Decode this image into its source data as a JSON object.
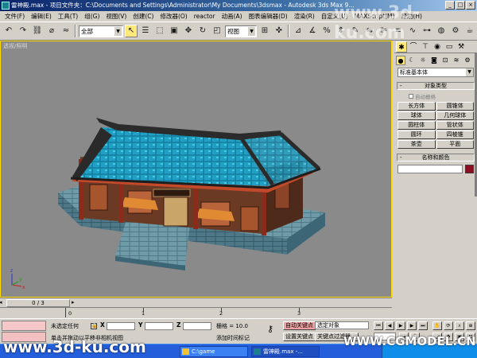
{
  "window": {
    "title": "雷神殿.max   - 项目文件夹：C:\\Documents and Settings\\Administrator\\My Documents\\3dsmax   - Autodesk 3ds Max 9...",
    "controls": [
      "_",
      "□",
      "×"
    ]
  },
  "menu": [
    "文件(F)",
    "编辑(E)",
    "工具(T)",
    "组(G)",
    "视图(V)",
    "创建(C)",
    "修改器(O)",
    "reactor",
    "动画(A)",
    "图表编辑器(D)",
    "渲染(R)",
    "自定义(U)",
    "MAXScript(M)",
    "帮助(H)"
  ],
  "toolbar": {
    "selection_filter": "全部",
    "coord_system": "视图"
  },
  "viewport": {
    "label": "透视/照明",
    "axes": {
      "x": "x",
      "y": "y",
      "z": "z"
    }
  },
  "command_panel": {
    "category_dropdown": "标准基本体",
    "object_type_header": "对象类型",
    "autogrid_label": "自动栅格",
    "object_buttons": [
      "长方体",
      "圆锥体",
      "球体",
      "几何球体",
      "圆柱体",
      "管状体",
      "圆环",
      "四棱锥",
      "茶壶",
      "平面"
    ],
    "name_color_header": "名称和颜色",
    "object_color": "#8b0f22"
  },
  "timeline": {
    "frame_display": "0 / 3",
    "ticks": [
      "0",
      "1",
      "2",
      "3"
    ]
  },
  "status": {
    "selection_status": "未选定任何",
    "prompt": "单击并拖动以平移非相机视图",
    "grid": "栅格 = 10.0",
    "auto_key": "自动关键点",
    "set_key": "设置关键点",
    "add_time_tag": "添加时间标记",
    "key_filter_selection": "选定对象",
    "key_filters": "关键点过滤器...",
    "coord_labels": [
      "X",
      "Y",
      "Z"
    ]
  },
  "taskbar": {
    "items": [
      "C:\\game",
      "雷神殿.max -..."
    ]
  },
  "watermarks": {
    "top_right": "www.3d-ku.com",
    "bottom_left": "www.3d-ku.com",
    "bottom_right": "WWW.CGMODEL.CN"
  }
}
